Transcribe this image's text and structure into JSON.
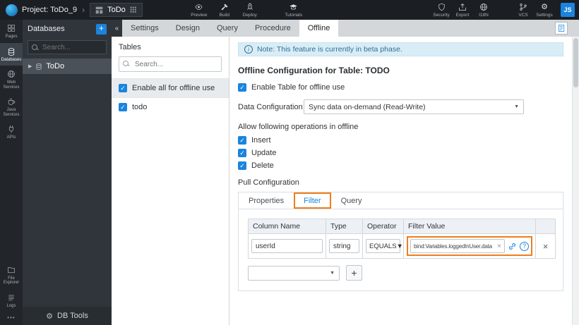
{
  "colors": {
    "accent": "#1a84de",
    "highlight_orange": "#ee7f1d",
    "note_bg": "#d9edf7",
    "note_text": "#31708f"
  },
  "icons": {
    "check": "✓",
    "plus": "+",
    "collapse": "«",
    "caret_right": "▶",
    "arrow_down": "▼",
    "close": "×",
    "delete": "×",
    "more": "•••",
    "info": "i",
    "gear": "⚙",
    "help": "?",
    "chevron_right": "›"
  },
  "topbar": {
    "project_label": "Project: ToDo_9",
    "app_name": "ToDo",
    "actions": [
      {
        "label": "Preview"
      },
      {
        "label": "Build"
      },
      {
        "label": "Deploy"
      },
      {
        "label": "Tutorials"
      }
    ],
    "right_actions": [
      {
        "label": "Security"
      },
      {
        "label": "Export"
      },
      {
        "label": "I18N"
      },
      {
        "label": "VCS"
      },
      {
        "label": "Settings"
      }
    ],
    "avatar_initials": "JS"
  },
  "rail": {
    "items": [
      {
        "label": "Pages"
      },
      {
        "label": "Databases"
      },
      {
        "label": "Web Services"
      },
      {
        "label": "Java Services"
      },
      {
        "label": "APIs"
      }
    ],
    "bottom_items": [
      {
        "label": "File Explorer"
      },
      {
        "label": "Logs"
      }
    ]
  },
  "db_panel": {
    "title": "Databases",
    "search_placeholder": "Search...",
    "tree_item": "ToDo",
    "footer_label": "DB Tools"
  },
  "tabs": {
    "items": [
      {
        "label": "Settings"
      },
      {
        "label": "Design"
      },
      {
        "label": "Query"
      },
      {
        "label": "Procedure"
      },
      {
        "label": "Offline"
      }
    ]
  },
  "tables_panel": {
    "title": "Tables",
    "search_placeholder": "Search...",
    "rows": [
      {
        "label": "Enable all for offline use"
      },
      {
        "label": "todo"
      }
    ]
  },
  "main": {
    "note": "Note: This feature is currently in beta phase.",
    "heading": "Offline Configuration for Table: TODO",
    "enable_label": "Enable Table for offline use",
    "data_config_label": "Data Configuration",
    "data_config_value": "Sync data on-demand (Read-Write)",
    "operations_label": "Allow following operations in offline",
    "operations": [
      {
        "label": "Insert"
      },
      {
        "label": "Update"
      },
      {
        "label": "Delete"
      }
    ],
    "pull_label": "Pull Configuration",
    "pull_tabs": [
      {
        "label": "Properties"
      },
      {
        "label": "Filter"
      },
      {
        "label": "Query"
      }
    ],
    "filter_table": {
      "headers": [
        "Column Name",
        "Type",
        "Operator",
        "Filter Value"
      ],
      "row": {
        "column_name": "userId",
        "type": "string",
        "operator": "EQUALS",
        "filter_value": "bind:Variables.loggedInUser.data"
      }
    }
  }
}
